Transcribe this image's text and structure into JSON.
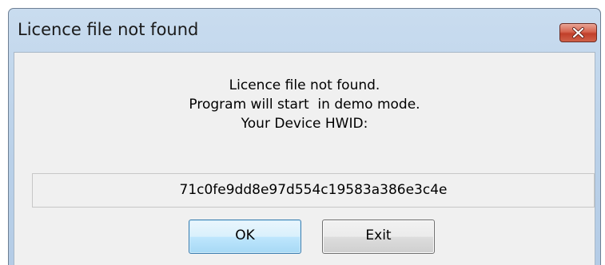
{
  "window": {
    "title": "Licence file not found",
    "close_icon": "close-icon"
  },
  "message": {
    "line1": "Licence file not found.",
    "line2": "Program will start  in demo mode.",
    "line3": "Your Device HWID:"
  },
  "hwid": {
    "value": "71c0fe9dd8e97d554c19583a386e3c4e"
  },
  "buttons": {
    "ok_label": "OK",
    "exit_label": "Exit"
  },
  "colors": {
    "frame": "#b9d0e8",
    "client": "#f0f0f0",
    "close_button": "#c74a33",
    "default_button_border": "#3c7fb1"
  }
}
